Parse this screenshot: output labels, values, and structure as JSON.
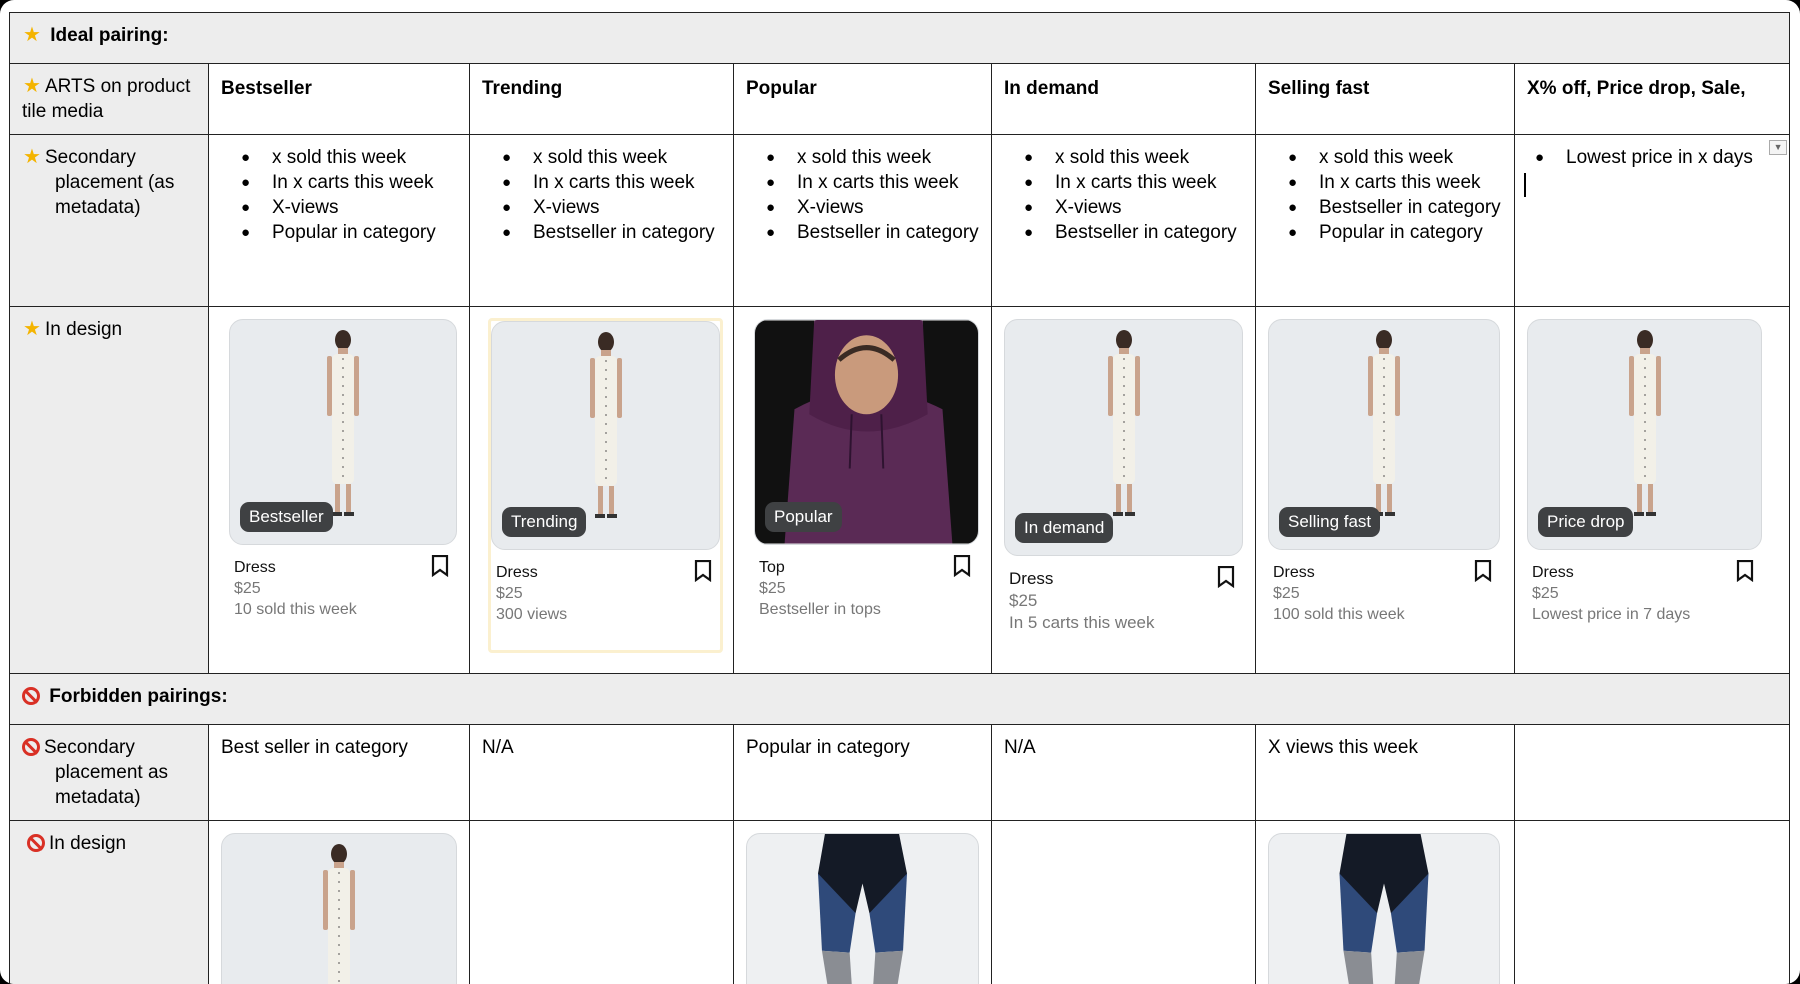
{
  "sections": {
    "ideal": "Ideal pairing:",
    "forbidden": "Forbidden pairings:"
  },
  "rows": {
    "arts_label": "ARTS on product tile media",
    "secondary_label_1": "Secondary",
    "secondary_label_2": "placement (as",
    "secondary_label_3": "metadata)",
    "in_design": "In design",
    "f_secondary_1": "Secondary",
    "f_secondary_2": "placement as",
    "f_secondary_3": "metadata)",
    "f_in_design": "In design"
  },
  "columns": [
    {
      "header": "Bestseller",
      "bullets": [
        "x sold this week",
        "In x carts this week",
        "X-views",
        "Popular in category"
      ]
    },
    {
      "header": "Trending",
      "bullets": [
        "x sold this week",
        "In x carts this week",
        "X-views",
        "Bestseller in category"
      ]
    },
    {
      "header": "Popular",
      "bullets": [
        "x sold this week",
        "In x carts this week",
        "X-views",
        "Bestseller in category"
      ]
    },
    {
      "header": "In demand",
      "bullets": [
        "x sold this week",
        "In x carts this week",
        "X-views",
        "Bestseller in category"
      ]
    },
    {
      "header": "Selling fast",
      "bullets": [
        "x sold this week",
        "In x carts this week",
        "Bestseller in category",
        "Popular in category"
      ]
    },
    {
      "header": "X% off, Price drop, Sale,",
      "bullets": [
        "Lowest price in x days"
      ]
    }
  ],
  "tiles": [
    {
      "badge": "Bestseller",
      "name": "Dress",
      "price": "$25",
      "meta": "10 sold this week"
    },
    {
      "badge": "Trending",
      "name": "Dress",
      "price": "$25",
      "meta": "300 views"
    },
    {
      "badge": "Popular",
      "name": "Top",
      "price": "$25",
      "meta": "Bestseller in tops"
    },
    {
      "badge": "In demand",
      "name": "Dress",
      "price": "$25",
      "meta": "In 5 carts this week"
    },
    {
      "badge": "Selling fast",
      "name": "Dress",
      "price": "$25",
      "meta": "100 sold this week"
    },
    {
      "badge": "Price drop",
      "name": "Dress",
      "price": "$25",
      "meta": "Lowest price in 7 days"
    }
  ],
  "forbidden": [
    "Best seller in category",
    "N/A",
    "Popular in category",
    "N/A",
    "X views this week",
    ""
  ],
  "colors": {
    "badge": "#3f4143",
    "label_bg": "#ededed",
    "star": "#f4b400",
    "ban": "#d93025",
    "hoodie": "#5a2a55"
  },
  "icons": [
    "star-icon",
    "ban-icon",
    "bookmark-icon",
    "bullet-icon",
    "dropdown-arrow-icon"
  ]
}
